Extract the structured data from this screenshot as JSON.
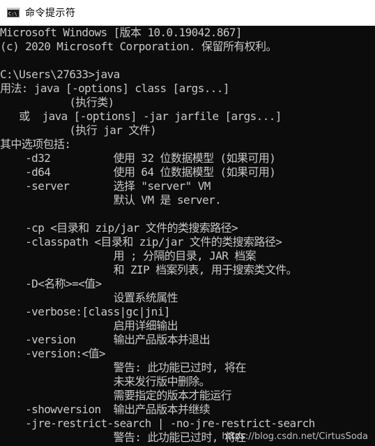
{
  "window": {
    "title": "命令提示符",
    "icon": "cmd-icon"
  },
  "console": {
    "lines": [
      "Microsoft Windows [版本 10.0.19042.867]",
      "(c) 2020 Microsoft Corporation. 保留所有权利。",
      "",
      "C:\\Users\\27633>java",
      "用法: java [-options] class [args...]",
      "           (执行类)",
      "   或  java [-options] -jar jarfile [args...]",
      "           (执行 jar 文件)",
      "其中选项包括:",
      "    -d32          使用 32 位数据模型 (如果可用)",
      "    -d64          使用 64 位数据模型 (如果可用)",
      "    -server       选择 \"server\" VM",
      "                  默认 VM 是 server.",
      "",
      "    -cp <目录和 zip/jar 文件的类搜索路径>",
      "    -classpath <目录和 zip/jar 文件的类搜索路径>",
      "                  用 ; 分隔的目录, JAR 档案",
      "                  和 ZIP 档案列表, 用于搜索类文件。",
      "    -D<名称>=<值>",
      "                  设置系统属性",
      "    -verbose:[class|gc|jni]",
      "                  启用详细输出",
      "    -version      输出产品版本并退出",
      "    -version:<值>",
      "                  警告: 此功能已过时, 将在",
      "                  未来发行版中删除。",
      "                  需要指定的版本才能运行",
      "    -showversion  输出产品版本并继续",
      "    -jre-restrict-search | -no-jre-restrict-search",
      "                  警告: 此功能已过时, 将在"
    ]
  },
  "watermark": "https://blog.csdn.net/CirtusSoda",
  "colors": {
    "console_bg": "#0c0c0c",
    "console_text": "#c8c8c8",
    "titlebar_bg": "#ffffff"
  }
}
